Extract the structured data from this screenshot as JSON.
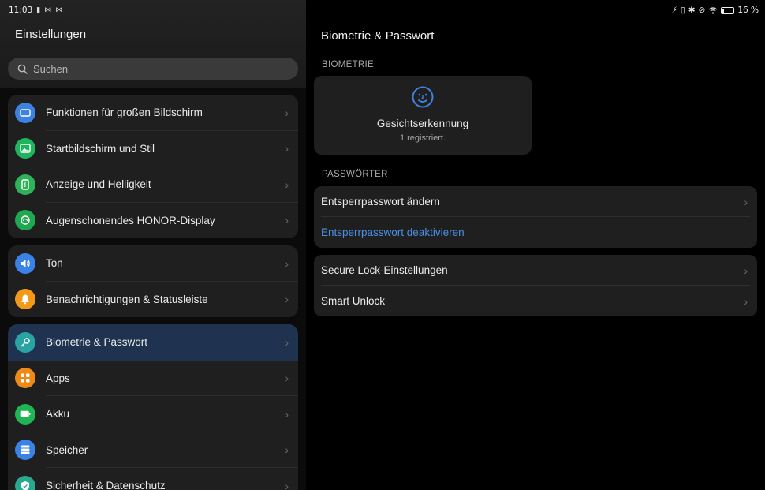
{
  "status_bar": {
    "time": "11:03",
    "battery_text": "16 %",
    "battery_level": 0.16
  },
  "left": {
    "title": "Einstellungen",
    "search_placeholder": "Suchen",
    "groups": [
      {
        "items": [
          {
            "label": "Funktionen für großen Bildschirm",
            "icon": "large-screen-icon",
            "color": "#3d82e0"
          },
          {
            "label": "Startbildschirm und Stil",
            "icon": "picture-icon",
            "color": "#1db55d"
          },
          {
            "label": "Anzeige und Helligkeit",
            "icon": "phone-brightness-icon",
            "color": "#2fb157"
          },
          {
            "label": "Augenschonendes HONOR-Display",
            "icon": "eye-comfort-icon",
            "color": "#1fa84f"
          }
        ]
      },
      {
        "items": [
          {
            "label": "Ton",
            "icon": "speaker-icon",
            "color": "#3b82e6"
          },
          {
            "label": "Benachrichtigungen & Statusleiste",
            "icon": "bell-icon",
            "color": "#f19a18"
          }
        ]
      },
      {
        "items": [
          {
            "label": "Biometrie & Passwort",
            "icon": "key-icon",
            "color": "#2aa3a3",
            "active": true
          },
          {
            "label": "Apps",
            "icon": "apps-grid-icon",
            "color": "#f08a17"
          },
          {
            "label": "Akku",
            "icon": "battery-icon",
            "color": "#1fb554"
          },
          {
            "label": "Speicher",
            "icon": "storage-icon",
            "color": "#3b82e6"
          },
          {
            "label": "Sicherheit & Datenschutz",
            "icon": "shield-icon",
            "color": "#2aa78f"
          }
        ]
      }
    ]
  },
  "right": {
    "title": "Biometrie & Passwort",
    "biometrics_section": "BIOMETRIE",
    "face": {
      "title": "Gesichtserkennung",
      "subtitle": "1 registriert.",
      "icon_color": "#3d82e0"
    },
    "passwords_section": "PASSWÖRTER",
    "password_items": [
      {
        "label": "Entsperrpasswort ändern",
        "link": false
      },
      {
        "label": "Entsperrpasswort deaktivieren",
        "link": true
      }
    ],
    "lock_items": [
      {
        "label": "Secure Lock-Einstellungen"
      },
      {
        "label": "Smart Unlock"
      }
    ]
  },
  "accent_color": "#4a8fe4"
}
